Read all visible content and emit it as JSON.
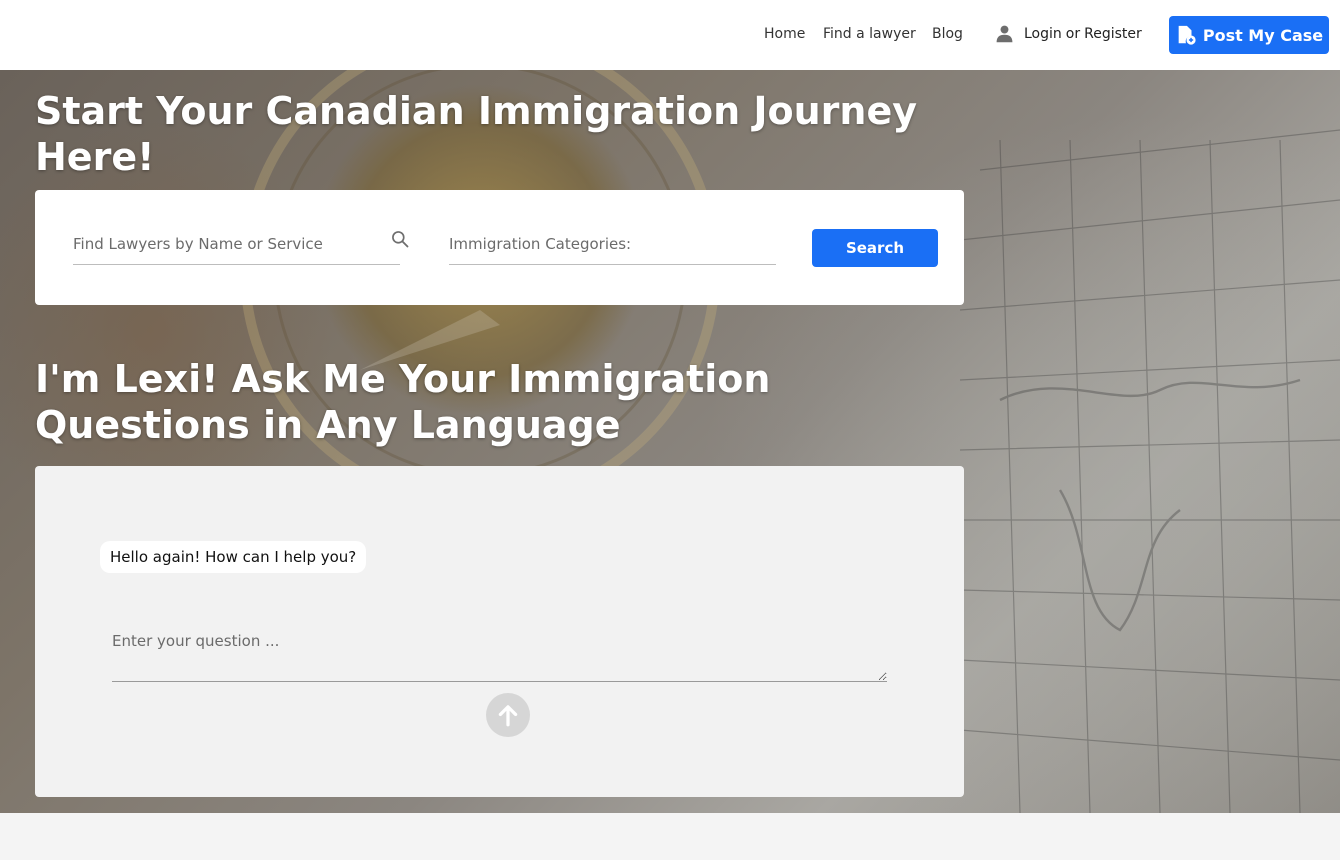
{
  "nav": {
    "links": [
      {
        "label": "Home"
      },
      {
        "label": "Find a lawyer"
      },
      {
        "label": "Blog"
      }
    ],
    "user_icon": "user-icon",
    "login_label": "Login",
    "or_label": "or",
    "register_label": "Register",
    "post_case_label": "Post My Case",
    "post_case_icon": "document-icon"
  },
  "hero": {
    "title": "Start Your Canadian Immigration Journey Here!"
  },
  "search": {
    "name_placeholder": "Find Lawyers by Name or Service",
    "category_placeholder": "Immigration Categories:",
    "button_label": "Search"
  },
  "chat": {
    "title": "I'm Lexi! Ask Me Your Immigration Questions in Any Language",
    "greeting": "Hello again! How can I help you?",
    "question_placeholder": "Enter your question ...",
    "send_icon": "arrow-up-icon"
  },
  "colors": {
    "accent": "#1a6ff5",
    "card_bg": "#ffffff",
    "chat_bg": "#f2f2f2"
  }
}
